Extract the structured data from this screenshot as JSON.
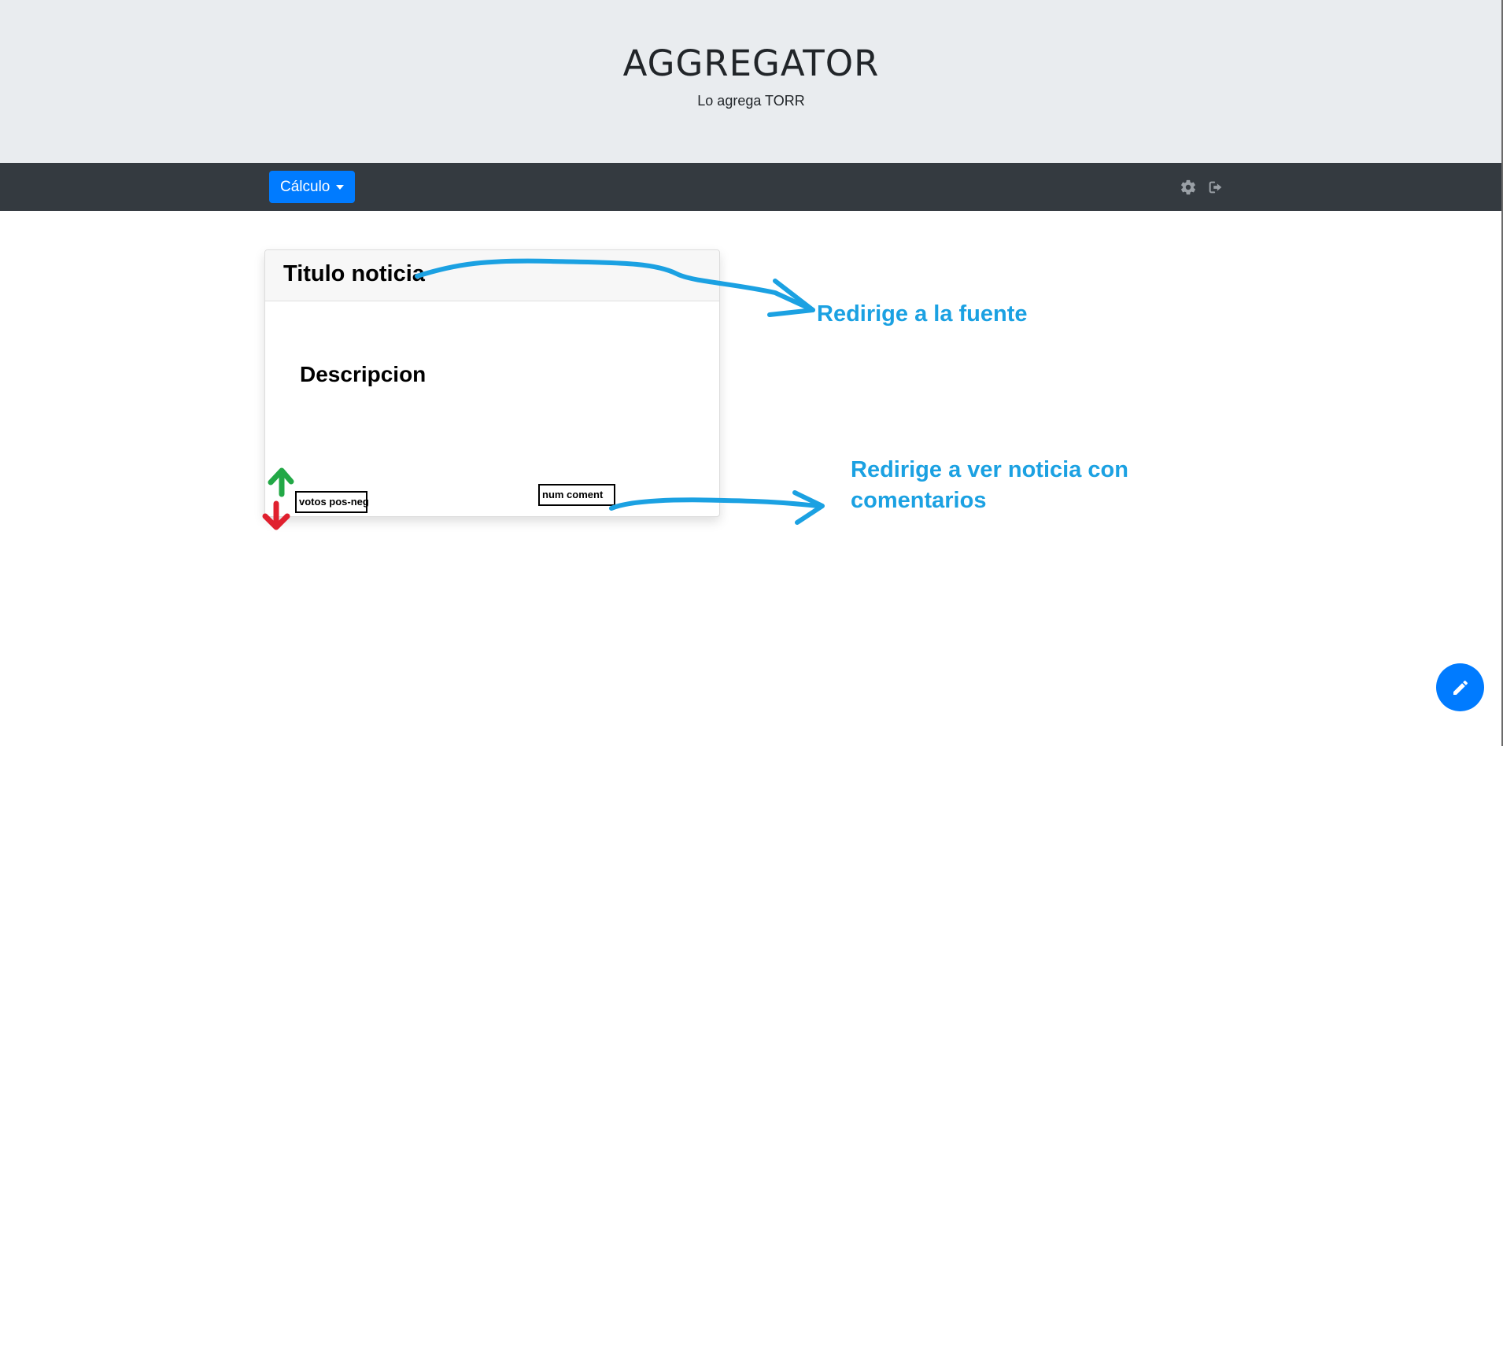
{
  "header": {
    "title": "AGGREGATOR",
    "subtitle": "Lo agrega TORR"
  },
  "navbar": {
    "dropdown_label": "Cálculo",
    "icons": [
      "gear-icon",
      "sign-out-icon"
    ]
  },
  "card": {
    "title": "Titulo noticia",
    "description": "Descripcion",
    "votes_label": "votos pos-neg",
    "comments_label": "num coment"
  },
  "annotations": {
    "source_note": "Redirige a la fuente",
    "comments_note": "Redirige a ver noticia con comentarios"
  },
  "fab": {
    "icon": "pencil-icon"
  },
  "colors": {
    "jumbotron_bg": "#e9ecef",
    "navbar_bg": "#343a40",
    "primary": "#007bff",
    "annotation": "#1ba1e2",
    "upvote": "#22a846",
    "downvote": "#e0202e"
  }
}
